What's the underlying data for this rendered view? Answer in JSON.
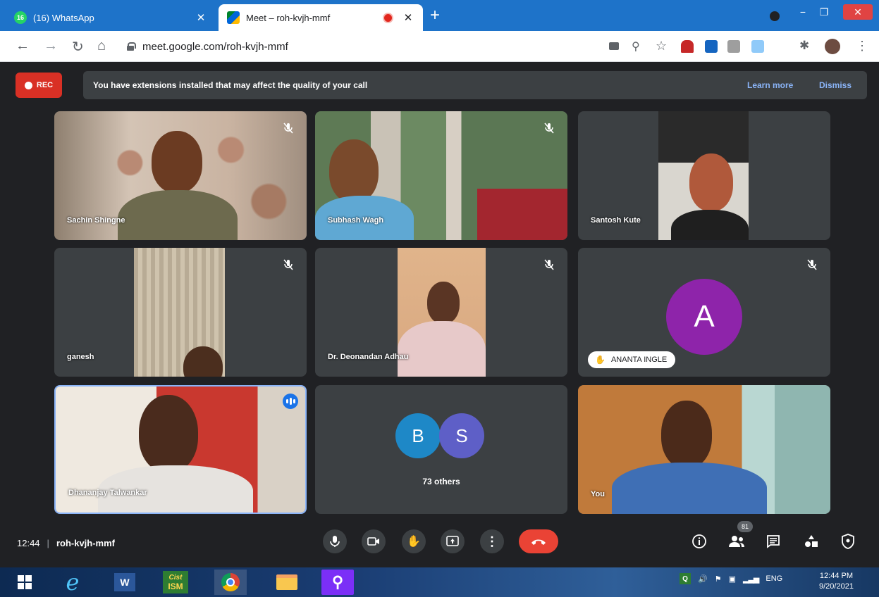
{
  "browser": {
    "tabs": [
      {
        "favicon_text": "16",
        "title": "(16) WhatsApp",
        "active": false
      },
      {
        "favicon_text": "",
        "title": "Meet – roh-kvjh-mmf",
        "active": true
      }
    ],
    "url": "meet.google.com/roh-kvjh-mmf",
    "new_tab_label": "+"
  },
  "meet": {
    "rec_label": "REC",
    "banner": {
      "message": "You have extensions installed that may affect the quality of your call",
      "learn_more": "Learn more",
      "dismiss": "Dismiss"
    },
    "tiles": [
      {
        "name": "Sachin Shingne",
        "muted": true
      },
      {
        "name": "Subhash Wagh",
        "muted": true
      },
      {
        "name": "Santosh Kute",
        "muted": false
      },
      {
        "name": "ganesh",
        "muted": true
      },
      {
        "name": "Dr. Deonandan Adhau",
        "muted": true
      },
      {
        "name": "ANANTA INGLE",
        "avatar_letter": "A",
        "avatar_color": "#8e24aa",
        "muted": true
      },
      {
        "name": "Dhananjay Talwankar",
        "speaking": true
      },
      {
        "name": "73 others",
        "avatars": [
          {
            "letter": "B",
            "color": "#1e88c7"
          },
          {
            "letter": "S",
            "color": "#5e5fc7"
          }
        ]
      },
      {
        "name": "You"
      }
    ],
    "meeting_time": "12:44",
    "meeting_code": "roh-kvjh-mmf",
    "participant_count": "81"
  },
  "taskbar": {
    "apps": [
      "start-button",
      "internet-explorer",
      "word",
      "cist-ism",
      "chrome",
      "file-explorer",
      "search-app"
    ],
    "ism_label": "ISM",
    "cist_label": "Cist",
    "language": "ENG",
    "time": "12:44 PM",
    "date": "9/20/2021"
  },
  "colors": {
    "accent": "#1a73e8",
    "end_call": "#ea4335",
    "rec": "#d93025",
    "tile_bg": "#3c4043",
    "page_bg": "#202124"
  }
}
